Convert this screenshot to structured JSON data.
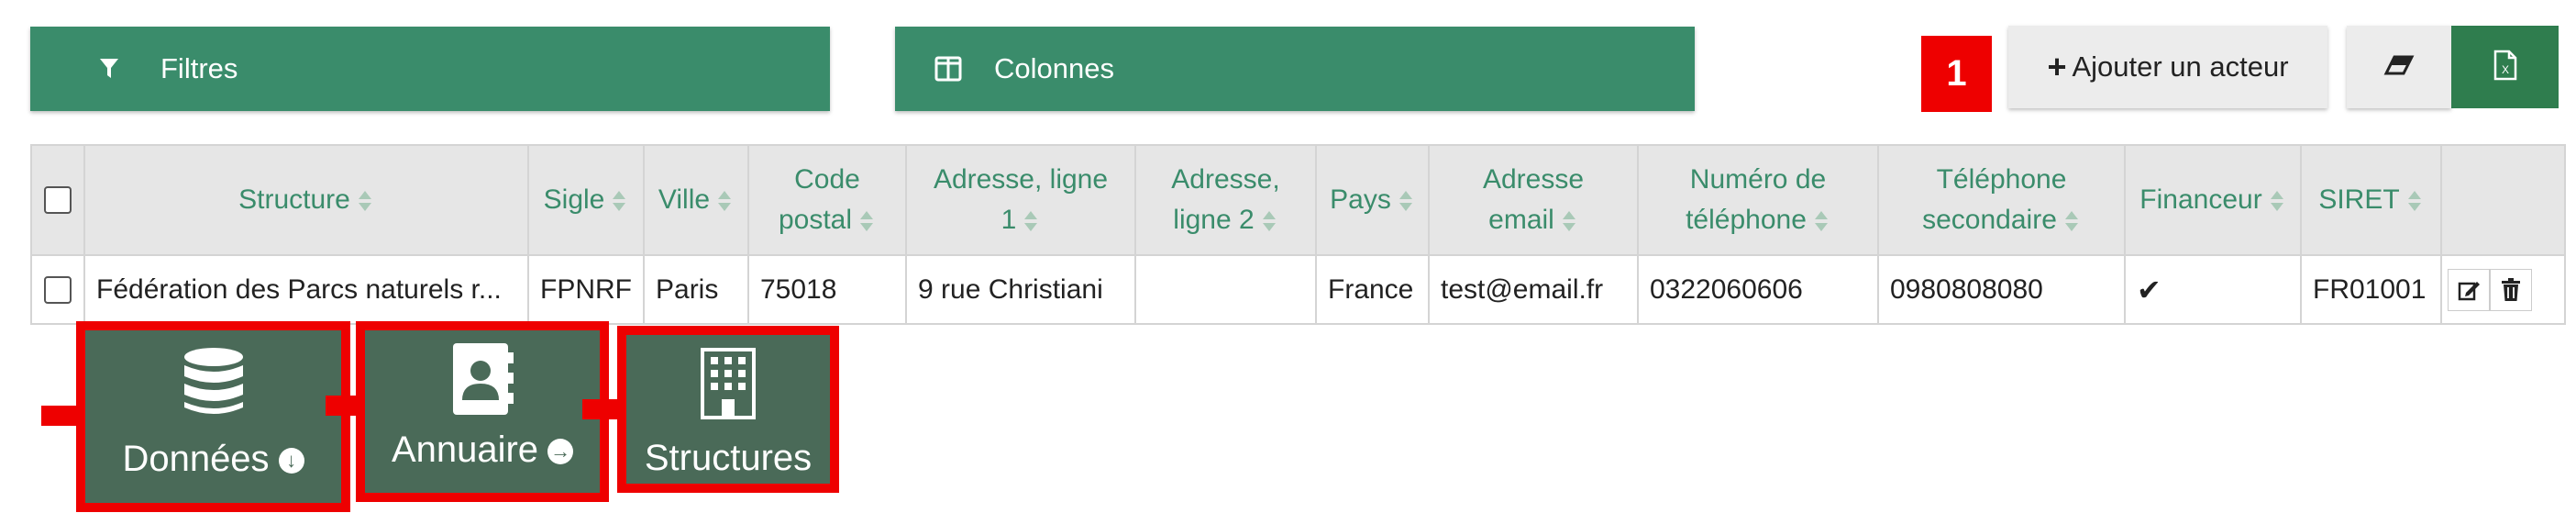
{
  "toolbar": {
    "filters_label": "Filtres",
    "columns_label": "Colonnes",
    "step_badge": "1",
    "add_actor_label": "Ajouter un acteur",
    "add_actor_icon": "plus-icon",
    "eraser_icon": "eraser-icon",
    "export_icon": "excel-export-icon"
  },
  "table": {
    "headers": [
      {
        "line1": "Structure",
        "line2": ""
      },
      {
        "line1": "Sigle",
        "line2": ""
      },
      {
        "line1": "Ville",
        "line2": ""
      },
      {
        "line1": "Code",
        "line2": "postal"
      },
      {
        "line1": "Adresse, ligne",
        "line2": "1"
      },
      {
        "line1": "Adresse,",
        "line2": "ligne 2"
      },
      {
        "line1": "Pays",
        "line2": ""
      },
      {
        "line1": "Adresse",
        "line2": "email"
      },
      {
        "line1": "Numéro de",
        "line2": "téléphone"
      },
      {
        "line1": "Téléphone",
        "line2": "secondaire"
      },
      {
        "line1": "Financeur",
        "line2": ""
      },
      {
        "line1": "SIRET",
        "line2": ""
      }
    ],
    "row": {
      "structure": "Fédération des Parcs naturels r...",
      "sigle": "FPNRF",
      "ville": "Paris",
      "code_postal": "75018",
      "adresse_1": "9 rue Christiani",
      "adresse_2": "",
      "pays": "France",
      "email": "test@email.fr",
      "telephone": "0322060606",
      "telephone_2": "0980808080",
      "financeur": "✔",
      "siret": "FR01001"
    }
  },
  "nav": {
    "donnees": "Données",
    "annuaire": "Annuaire",
    "structures": "Structures"
  },
  "colors": {
    "accent": "#3a8c6b",
    "highlight": "#ee0000",
    "tile": "#4a6a58",
    "export": "#2f7d4e"
  }
}
